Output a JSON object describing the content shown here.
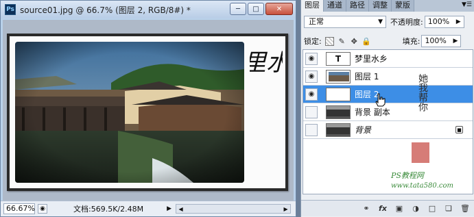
{
  "document": {
    "app_icon": "Ps",
    "title": "source01.jpg @ 66.7% (图层 2, RGB/8#) *",
    "window_buttons": [
      "minimize-icon",
      "restore-icon",
      "close-icon"
    ],
    "calligraphy": "夢里水鄉",
    "status": {
      "zoom": "66.67%",
      "doc_info": "文档:569.5K/2.48M"
    }
  },
  "panel": {
    "tabs": [
      "图层",
      "通道",
      "路径",
      "调整",
      "蒙版"
    ],
    "active_tab": 0,
    "blend_mode": "正常",
    "opacity_label": "不透明度:",
    "opacity_value": "100%",
    "lock_label": "锁定:",
    "fill_label": "填充:",
    "fill_value": "100%",
    "layers": [
      {
        "name": "梦里水乡",
        "type": "text",
        "thumb_text": "T",
        "visible": true,
        "selected": false,
        "locked": false
      },
      {
        "name": "图层 1",
        "type": "image",
        "visible": true,
        "selected": false,
        "locked": false
      },
      {
        "name": "图层 2",
        "type": "fill",
        "visible": true,
        "selected": true,
        "locked": false
      },
      {
        "name": "背景 副本",
        "type": "image",
        "visible": false,
        "selected": false,
        "locked": false
      },
      {
        "name": "背景",
        "type": "image",
        "visible": false,
        "selected": false,
        "locked": true
      }
    ],
    "footer_icons": [
      "link-icon",
      "fx-icon",
      "mask-icon",
      "adjustment-icon",
      "group-icon",
      "new-layer-icon",
      "trash-icon"
    ]
  },
  "watermark": {
    "vertical_text": "他她我帮你",
    "site_text": "PS教程网",
    "url_text": "www.tata580.com"
  },
  "colors": {
    "selection": "#3d8ee6",
    "title_bar": "#b8cde6",
    "watermark_green": "#3c8c3c"
  }
}
